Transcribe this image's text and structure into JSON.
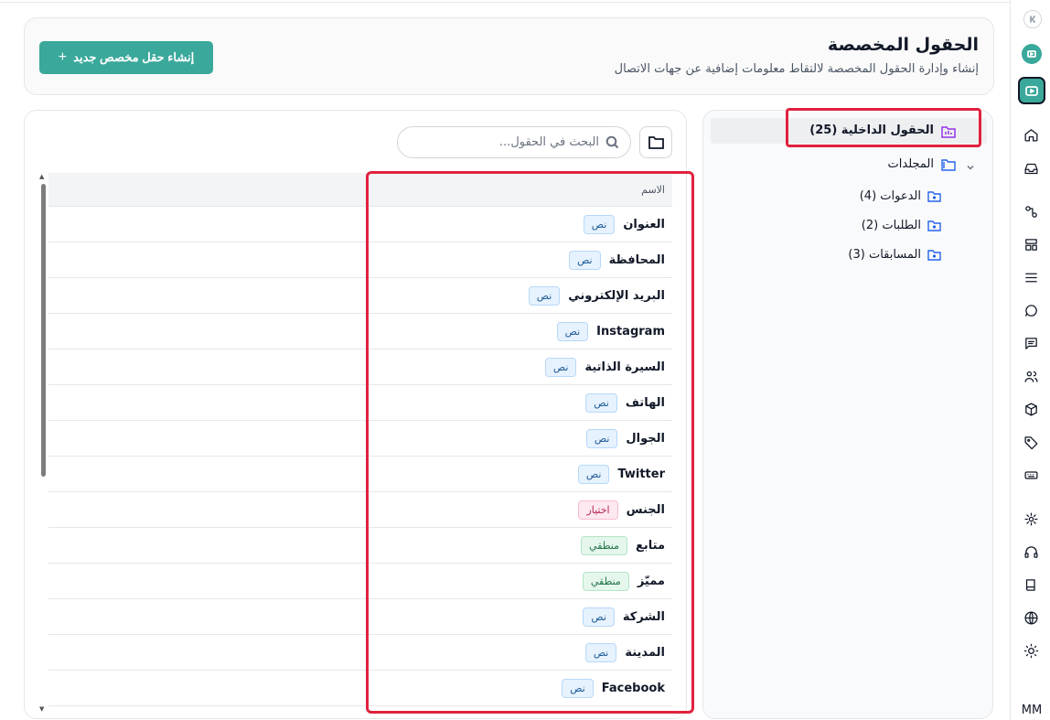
{
  "header": {
    "title": "الحقول المخصصة",
    "subtitle": "إنشاء وإدارة الحقول المخصصة لالتقاط معلومات إضافية عن جهات الاتصال",
    "create_button": "إنشاء حقل مخصص جديد",
    "create_icon": "plus-icon"
  },
  "sidebar": {
    "internal_fields": "الحقول الداخلية (25)",
    "folders_label": "المجلدات",
    "subfolders": [
      "الدعوات (4)",
      "الطلبات (2)",
      "المسابقات (3)"
    ]
  },
  "fields": {
    "search_placeholder": "البحث في الحقول...",
    "column_name": "الاسم",
    "rows": [
      {
        "name": "العنوان",
        "type": "نص",
        "kind": "text"
      },
      {
        "name": "المحافظة",
        "type": "نص",
        "kind": "text"
      },
      {
        "name": "البريد الإلكتروني",
        "type": "نص",
        "kind": "text"
      },
      {
        "name": "Instagram",
        "type": "نص",
        "kind": "text"
      },
      {
        "name": "السيرة الذاتية",
        "type": "نص",
        "kind": "text"
      },
      {
        "name": "الهاتف",
        "type": "نص",
        "kind": "text"
      },
      {
        "name": "الجوال",
        "type": "نص",
        "kind": "text"
      },
      {
        "name": "Twitter",
        "type": "نص",
        "kind": "text"
      },
      {
        "name": "الجنس",
        "type": "اختيار",
        "kind": "choice"
      },
      {
        "name": "متابع",
        "type": "منطقي",
        "kind": "bool"
      },
      {
        "name": "مميّز",
        "type": "منطقي",
        "kind": "bool"
      },
      {
        "name": "الشركة",
        "type": "نص",
        "kind": "text"
      },
      {
        "name": "المدينة",
        "type": "نص",
        "kind": "text"
      },
      {
        "name": "Facebook",
        "type": "نص",
        "kind": "text"
      }
    ]
  },
  "rail": {
    "user_initials": "MM",
    "icons": [
      "home-icon",
      "inbox-icon",
      "workflow-icon",
      "layout-icon",
      "list-icon",
      "chat-icon",
      "message-icon",
      "users-icon",
      "package-icon",
      "tag-icon",
      "keyboard-icon",
      "settings-icon",
      "headphones-icon",
      "book-icon",
      "globe-icon",
      "sun-icon"
    ]
  },
  "colors": {
    "accent": "#3aa89b",
    "highlight": "#e0223f"
  }
}
